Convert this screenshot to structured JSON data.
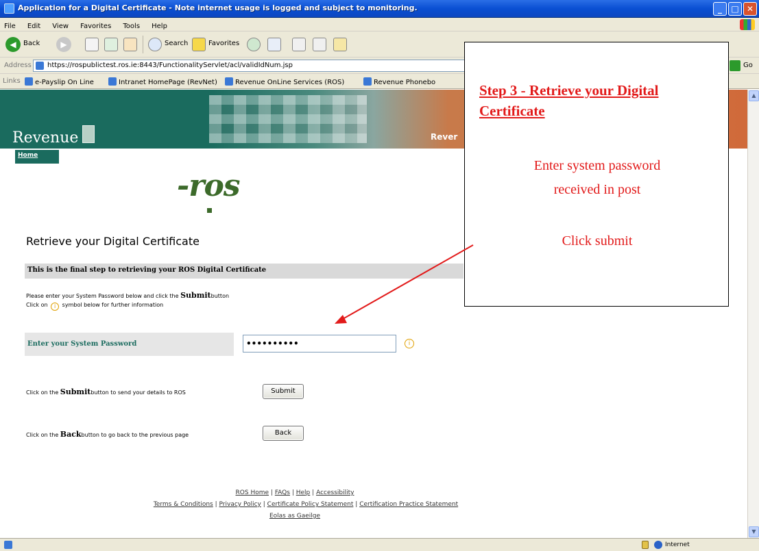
{
  "window": {
    "title": "Application for a Digital Certificate - Note internet usage is logged and subject to monitoring."
  },
  "menu": [
    "File",
    "Edit",
    "View",
    "Favorites",
    "Tools",
    "Help"
  ],
  "toolbar": {
    "back_label": "Back",
    "search_label": "Search",
    "favorites_label": "Favorites"
  },
  "address": {
    "label": "Address",
    "url": "https://rospublictest.ros.ie:8443/FunctionalityServlet/acl/validIdNum.jsp",
    "go_label": "Go"
  },
  "links": {
    "label": "Links",
    "items": [
      "e-Payslip On Line",
      "Intranet HomePage (RevNet)",
      "Revenue OnLine Services (ROS)",
      "Revenue Phonebo"
    ]
  },
  "banner": {
    "brand": "Revenue",
    "right_text": "Rever",
    "home_link": "Home"
  },
  "ros_logo": "-ros",
  "page": {
    "heading": "Retrieve your Digital Certificate",
    "info_bar": "This is the final step to retrieving your ROS Digital Certificate",
    "instr1_pre": "Please enter your System Password below and click the",
    "instr1_bold": "Submit",
    "instr1_post": "button",
    "instr2_pre": "Click on",
    "instr2_icon": "i",
    "instr2_post": "symbol below for further information",
    "password_label": "Enter your System Password",
    "password_value": "••••••••••",
    "submit_caption_pre": "Click on the",
    "submit_caption_bold": "Submit",
    "submit_caption_post": "button to send your details to ROS",
    "submit_button": "Submit",
    "back_caption_pre": "Click on the",
    "back_caption_bold": "Back",
    "back_caption_post": "button to go back to the previous page",
    "back_button": "Back"
  },
  "footer": {
    "row1": [
      "ROS Home",
      "FAQs",
      "Help",
      "Accessibility"
    ],
    "row2": [
      "Terms & Conditions",
      "Privacy Policy",
      "Certificate Policy Statement",
      "Certification Practice Statement"
    ],
    "row3": "Eolas as Gaeilge"
  },
  "callout": {
    "heading": "Step 3 - Retrieve your Digital Certificate",
    "line1": "Enter system password",
    "line2": "received in post",
    "line3": "Click submit",
    "color": "#e21a1a"
  },
  "status": {
    "zone": "Internet"
  }
}
